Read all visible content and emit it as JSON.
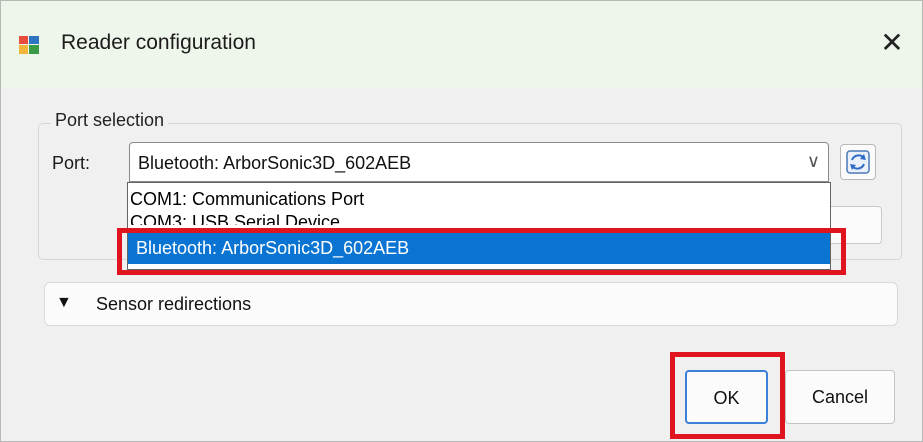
{
  "window": {
    "title": "Reader configuration",
    "close_glyph": "✕",
    "app_icon": "app-form-icon"
  },
  "port_selection": {
    "legend": "Port selection",
    "port_label": "Port:",
    "selected_port": "Bluetooth: ArborSonic3D_602AEB",
    "arrow_glyph": "∨",
    "refresh_icon": "refresh-icon",
    "options": [
      "COM1: Communications Port",
      "COM3: USB Serial Device",
      "Bluetooth: ArborSonic3D_602AEB"
    ],
    "highlighted_option_index": 2
  },
  "sensor_redirections": {
    "arrow_glyph": "▼",
    "label": "Sensor redirections"
  },
  "buttons": {
    "ok_label": "OK",
    "cancel_label": "Cancel"
  },
  "colors": {
    "selection_blue": "#0a74d3",
    "annotation_red": "#e0141e",
    "focus_border": "#3b7fd8"
  }
}
